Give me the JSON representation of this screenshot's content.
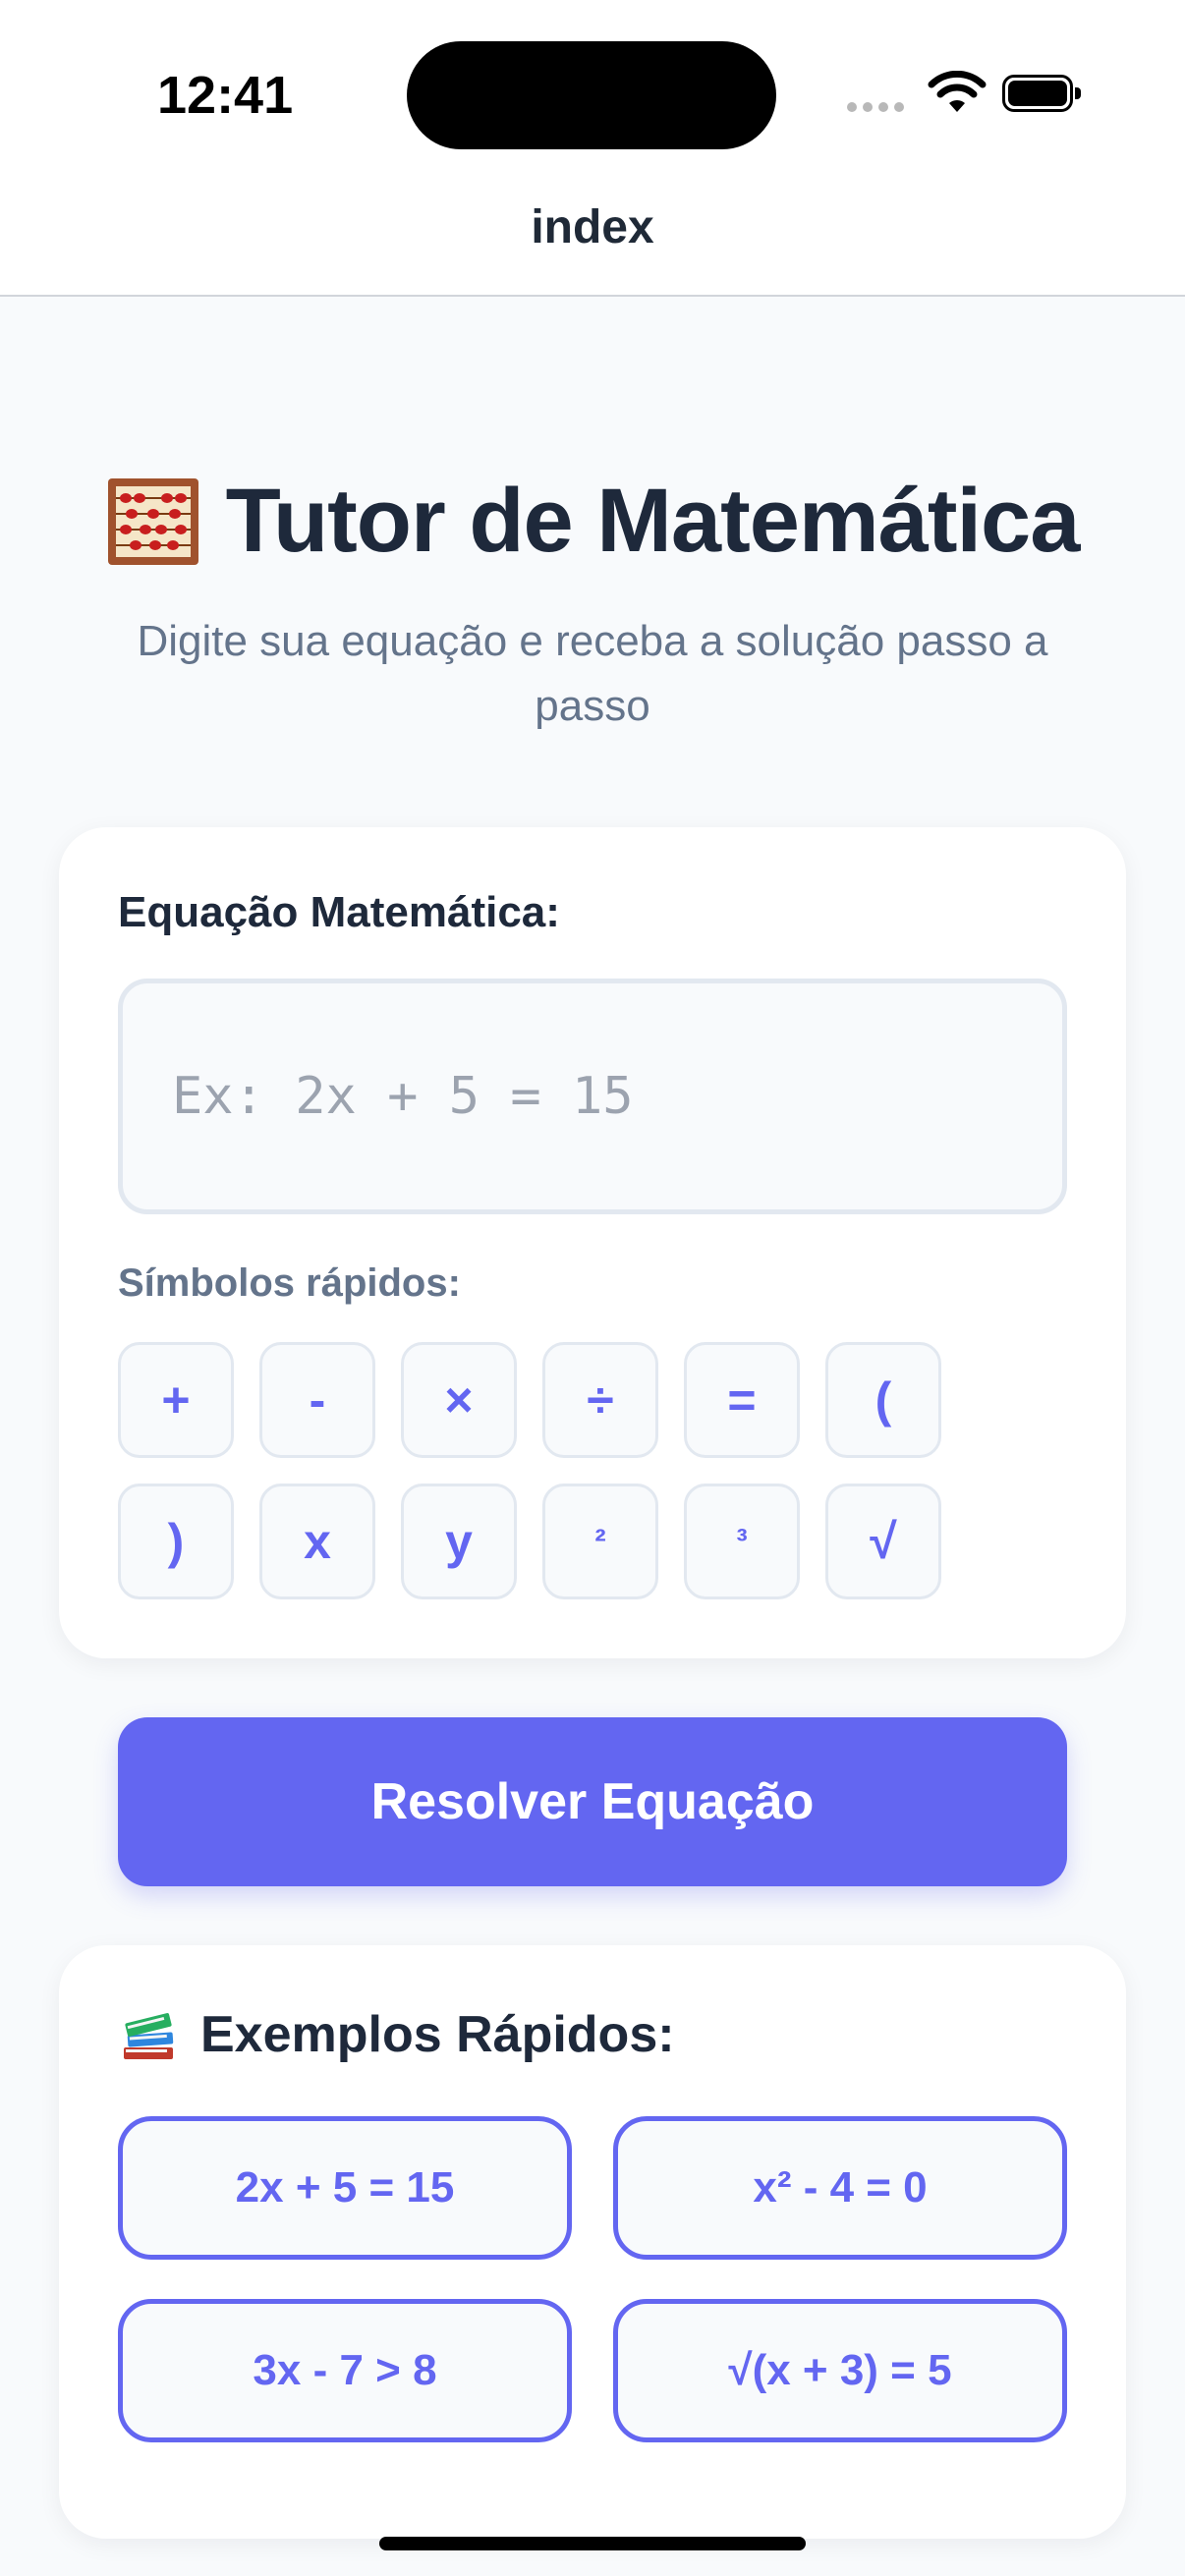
{
  "status_bar": {
    "time": "12:41"
  },
  "nav": {
    "title": "index"
  },
  "header": {
    "title": "Tutor de Matemática",
    "subtitle": "Digite sua equação e receba a solução passo a passo"
  },
  "input_card": {
    "label": "Equação Matemática:",
    "input_value": "",
    "input_placeholder": "Ex: 2x + 5 = 15",
    "symbols_label": "Símbolos rápidos:",
    "symbols": [
      "+",
      "-",
      "×",
      "÷",
      "=",
      "(",
      ")",
      "x",
      "y",
      "²",
      "³",
      "√"
    ]
  },
  "solve_button": {
    "label": "Resolver Equação"
  },
  "examples": {
    "title": "Exemplos Rápidos:",
    "items": [
      "2x + 5 = 15",
      "x² - 4 = 0",
      "3x - 7 > 8",
      "√(x + 3) = 5"
    ]
  },
  "icons": {
    "title_icon": "abacus-icon",
    "examples_icon": "books-icon"
  },
  "colors": {
    "accent": "#6366f1",
    "background": "#f8fafc",
    "text": "#1e293b",
    "muted": "#64748b"
  }
}
